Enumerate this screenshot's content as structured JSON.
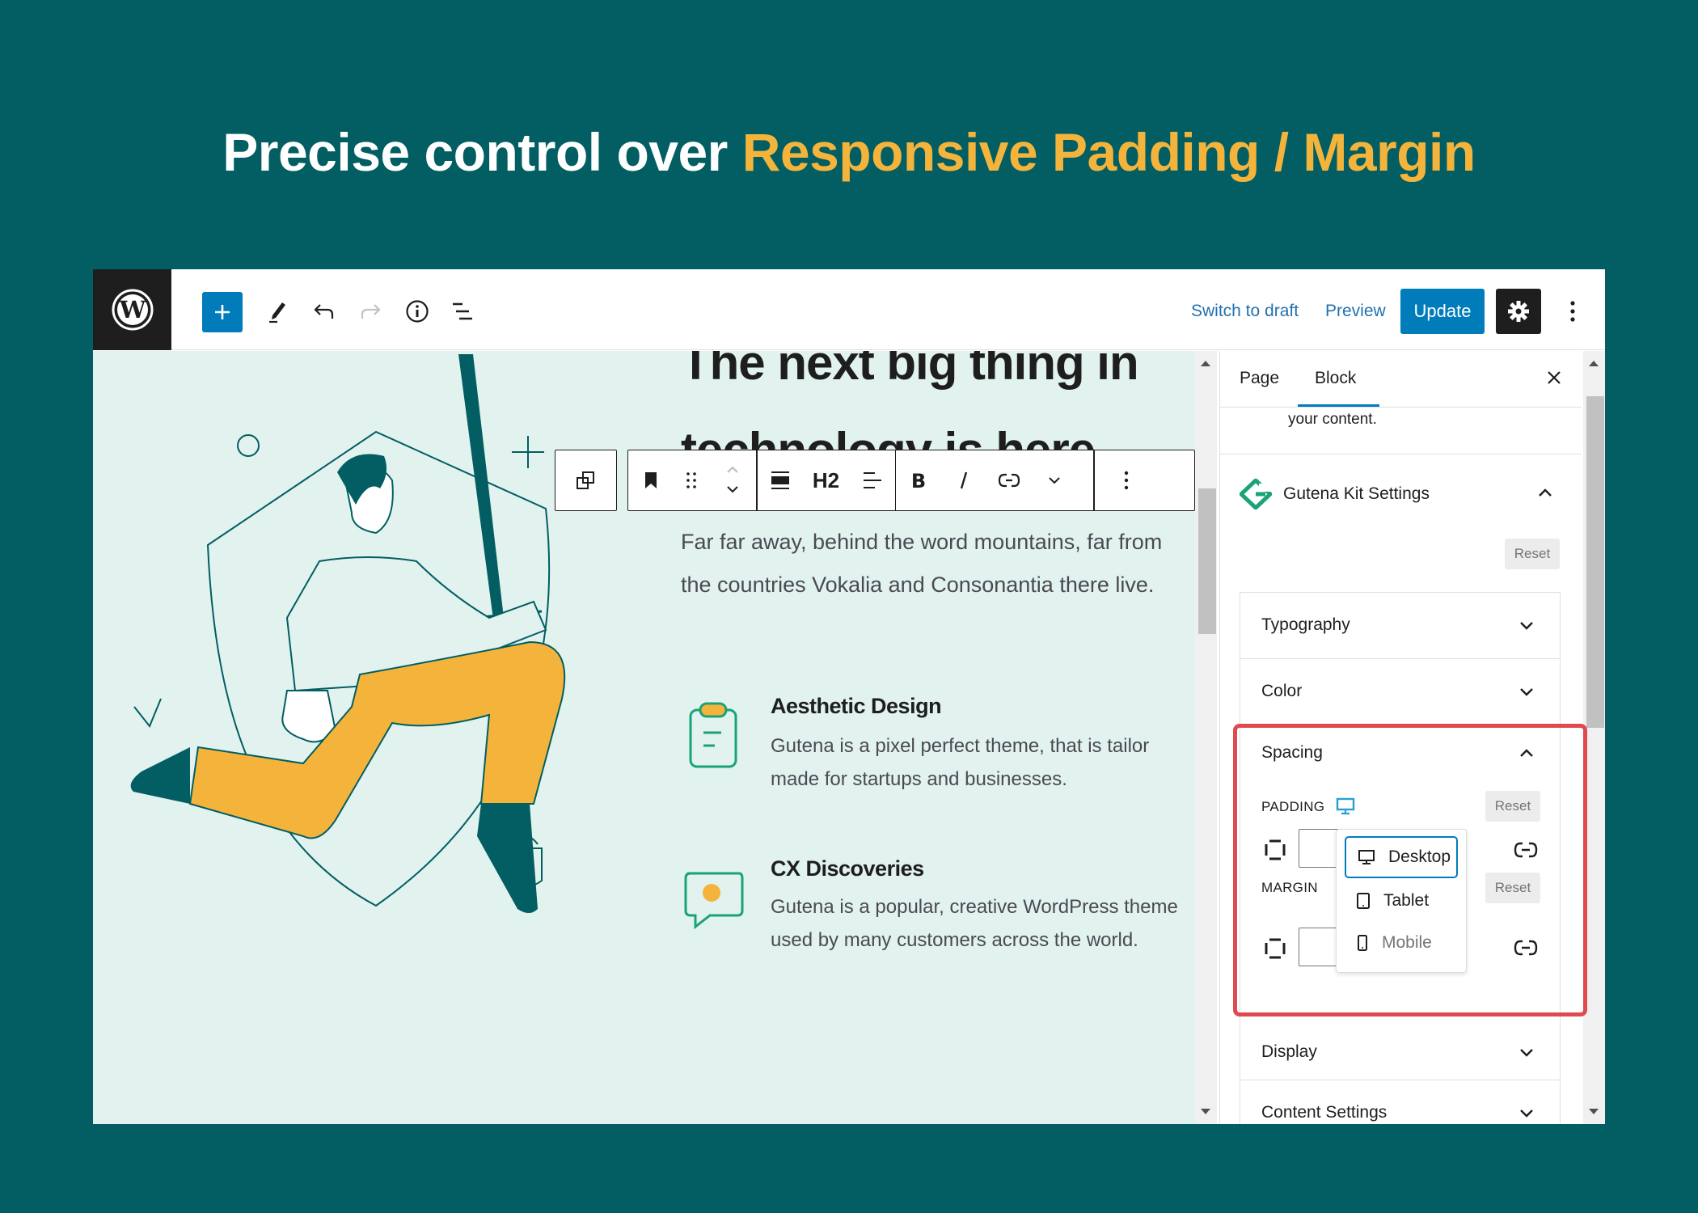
{
  "headline": {
    "prefix": "Precise control over",
    "accent": "Responsive Padding / Margin"
  },
  "colors": {
    "background": "#025e62",
    "accent": "#f4b43c",
    "wp_blue": "#007cba",
    "highlight_red": "#e04a4f",
    "canvas_bg": "#e1f2ef",
    "gutena_green": "#1aa37a"
  },
  "topbar": {
    "icons": [
      "wordpress-logo",
      "add-block-icon",
      "pencil-edit-icon",
      "undo-icon",
      "redo-icon",
      "info-icon",
      "list-view-icon"
    ],
    "switch_to_draft": "Switch to draft",
    "preview": "Preview",
    "update": "Update",
    "settings_icon": "gear-icon",
    "more_icon": "vertical-ellipsis-icon"
  },
  "block_toolbar": {
    "heading_level": "H2",
    "icons": [
      "transform-icon",
      "bookmark-icon",
      "drag-handle-icon",
      "move-up-down-icon",
      "align-icon",
      "text-align-icon",
      "bold-icon",
      "italic-icon",
      "link-icon",
      "more-rich-text-chevron-icon",
      "options-ellipsis-icon"
    ]
  },
  "canvas": {
    "heading_line1": "The next big thing in",
    "heading_line2": "technology is here",
    "lead": "Far far away, behind the word mountains, far from the countries Vokalia and Consonantia there live.",
    "features": [
      {
        "icon": "clipboard-icon",
        "title": "Aesthetic Design",
        "text": "Gutena is a pixel perfect theme, that is tailor made for startups and businesses."
      },
      {
        "icon": "chat-bubble-icon",
        "title": "CX Discoveries",
        "text": "Gutena is a popular, creative WordPress theme used by many customers across the world."
      }
    ]
  },
  "sidebar": {
    "tabs": [
      {
        "label": "Page",
        "active": false
      },
      {
        "label": "Block",
        "active": true
      }
    ],
    "description_tail": "your content.",
    "gutena_kit": {
      "title": "Gutena Kit Settings",
      "reset": "Reset"
    },
    "panels": [
      {
        "label": "Typography",
        "expanded": false
      },
      {
        "label": "Color",
        "expanded": false
      },
      {
        "label": "Spacing",
        "expanded": true
      },
      {
        "label": "Display",
        "expanded": false
      },
      {
        "label": "Content Settings",
        "expanded": false
      }
    ],
    "spacing": {
      "padding_label": "PADDING",
      "margin_label": "MARGIN",
      "reset": "Reset",
      "padding_value": "",
      "margin_value": "",
      "device_menu": [
        {
          "label": "Desktop",
          "icon": "desktop-icon",
          "selected": true
        },
        {
          "label": "Tablet",
          "icon": "tablet-icon",
          "selected": false
        },
        {
          "label": "Mobile",
          "icon": "mobile-icon",
          "selected": false
        }
      ]
    }
  }
}
